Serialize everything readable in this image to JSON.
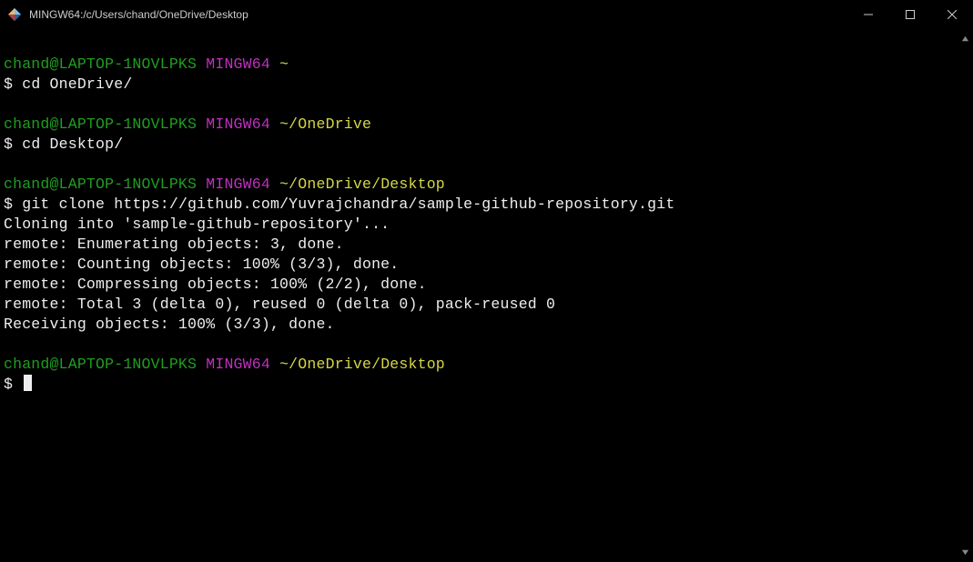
{
  "window": {
    "title": "MINGW64:/c/Users/chand/OneDrive/Desktop"
  },
  "colors": {
    "user_host": "#1f9f1f",
    "env": "#c030c0",
    "path": "#d6d64a",
    "fg": "#eeeeee",
    "bg": "#000000"
  },
  "prompts": [
    {
      "user_host": "chand@LAPTOP-1NOVLPKS",
      "env": "MINGW64",
      "path": "~",
      "command": "cd OneDrive/",
      "output": []
    },
    {
      "user_host": "chand@LAPTOP-1NOVLPKS",
      "env": "MINGW64",
      "path": "~/OneDrive",
      "command": "cd Desktop/",
      "output": []
    },
    {
      "user_host": "chand@LAPTOP-1NOVLPKS",
      "env": "MINGW64",
      "path": "~/OneDrive/Desktop",
      "command": "git clone https://github.com/Yuvrajchandra/sample-github-repository.git",
      "output": [
        "Cloning into 'sample-github-repository'...",
        "remote: Enumerating objects: 3, done.",
        "remote: Counting objects: 100% (3/3), done.",
        "remote: Compressing objects: 100% (2/2), done.",
        "remote: Total 3 (delta 0), reused 0 (delta 0), pack-reused 0",
        "Receiving objects: 100% (3/3), done."
      ]
    },
    {
      "user_host": "chand@LAPTOP-1NOVLPKS",
      "env": "MINGW64",
      "path": "~/OneDrive/Desktop",
      "command": "",
      "output": []
    }
  ],
  "symbols": {
    "prompt": "$"
  }
}
